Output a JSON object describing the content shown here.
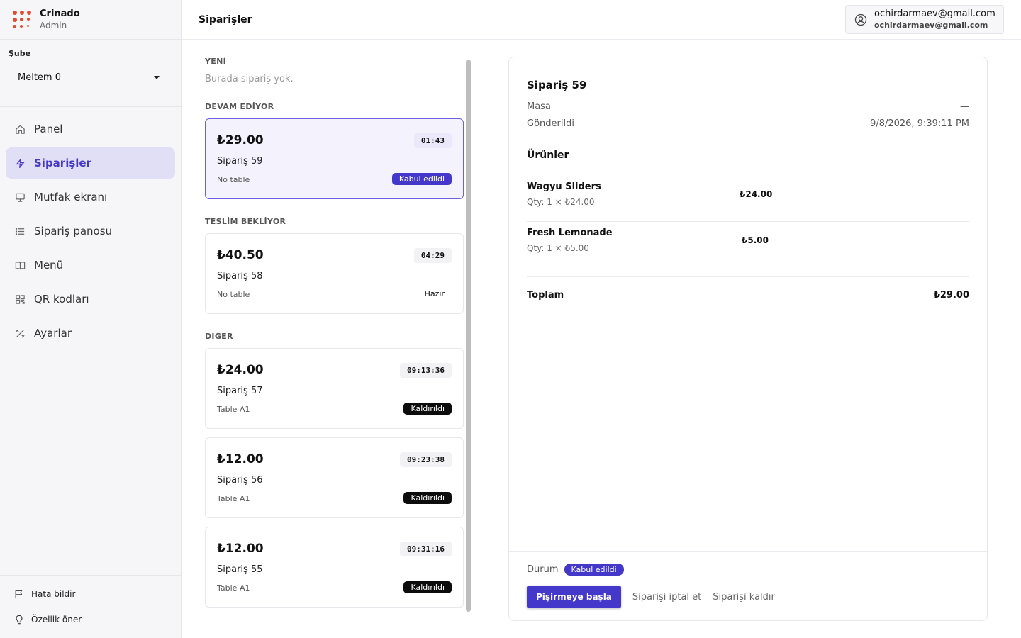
{
  "brand": {
    "name": "Crinado",
    "role": "Admin",
    "accent": "#e8492c"
  },
  "branch": {
    "label": "Şube",
    "selected": "Meltem 0"
  },
  "nav": [
    {
      "label": "Panel",
      "icon": "home-icon",
      "active": false
    },
    {
      "label": "Siparişler",
      "icon": "lightning-icon",
      "active": true
    },
    {
      "label": "Mutfak ekranı",
      "icon": "monitor-icon",
      "active": false
    },
    {
      "label": "Sipariş panosu",
      "icon": "list-icon",
      "active": false
    },
    {
      "label": "Menü",
      "icon": "book-icon",
      "active": false
    },
    {
      "label": "QR kodları",
      "icon": "qr-icon",
      "active": false
    },
    {
      "label": "Ayarlar",
      "icon": "tools-icon",
      "active": false
    }
  ],
  "footer": {
    "report": "Hata bildir",
    "suggest": "Özellik öner"
  },
  "header": {
    "title": "Siparişler"
  },
  "account": {
    "primary": "ochirdarmaev@gmail.com",
    "secondary": "ochirdarmaev@gmail.com"
  },
  "sections": {
    "new": {
      "label": "YENİ",
      "empty": "Burada sipariş yok."
    },
    "in_progress": {
      "label": "DEVAM EDİYOR"
    },
    "awaiting": {
      "label": "TESLİM BEKLİYOR"
    },
    "other": {
      "label": "DİĞER"
    }
  },
  "orders": [
    {
      "price": "₺29.00",
      "timer": "01:43",
      "name": "Sipariş 59",
      "table": "No table",
      "status": "Kabul edildi"
    },
    {
      "price": "₺40.50",
      "timer": "04:29",
      "name": "Sipariş 58",
      "table": "No table",
      "status": "Hazır"
    },
    {
      "price": "₺24.00",
      "timer": "09:13:36",
      "name": "Sipariş 57",
      "table": "Table A1",
      "status": "Kaldırıldı"
    },
    {
      "price": "₺12.00",
      "timer": "09:23:38",
      "name": "Sipariş 56",
      "table": "Table A1",
      "status": "Kaldırıldı"
    },
    {
      "price": "₺12.00",
      "timer": "09:31:16",
      "name": "Sipariş 55",
      "table": "Table A1",
      "status": "Kaldırıldı"
    }
  ],
  "detail": {
    "title": "Sipariş 59",
    "table_label": "Masa",
    "table_value": "—",
    "sent_label": "Gönderildi",
    "sent_value": "9/8/2026, 9:39:11 PM",
    "items_title": "Ürünler",
    "items": [
      {
        "name": "Wagyu Sliders",
        "qty": "Qty: 1 × ₺24.00",
        "price": "₺24.00"
      },
      {
        "name": "Fresh Lemonade",
        "qty": "Qty: 1 × ₺5.00",
        "price": "₺5.00"
      }
    ],
    "total_label": "Toplam",
    "total_value": "₺29.00",
    "status_label": "Durum",
    "status_value": "Kabul edildi",
    "primary_action": "Pişirmeye başla",
    "cancel_action": "Siparişi iptal et",
    "remove_action": "Siparişi kaldır"
  },
  "colors": {
    "accent": "#4338ca",
    "active_bg": "#e1dff5",
    "removed_badge": "#0c0c0c"
  }
}
